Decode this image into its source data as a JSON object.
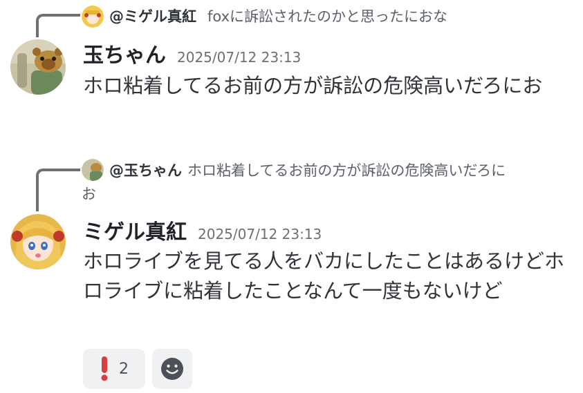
{
  "messages": [
    {
      "reply": {
        "author": "@ミゲル真紅",
        "text": "foxに訴訟されたのかと思ったにおな"
      },
      "author": "玉ちゃん",
      "timestamp": "2025/07/12 23:13",
      "content": "ホロ粘着してるお前の方が訴訟の危険高いだろにお"
    },
    {
      "reply": {
        "author": "@玉ちゃん",
        "text_line1": "ホロ粘着してるお前の方が訴訟の危険高いだろに",
        "text_line2": "お"
      },
      "author": "ミゲル真紅",
      "timestamp": "2025/07/12 23:13",
      "content": "ホロライブを見てる人をバカにしたことはあるけどホロライブに粘着したことなんて一度もないけど"
    }
  ],
  "reactions": [
    {
      "emoji": "❗",
      "count": "2"
    }
  ],
  "colors": {
    "accent_red": "#d83c3e",
    "reply_line": "#6b6f76"
  }
}
